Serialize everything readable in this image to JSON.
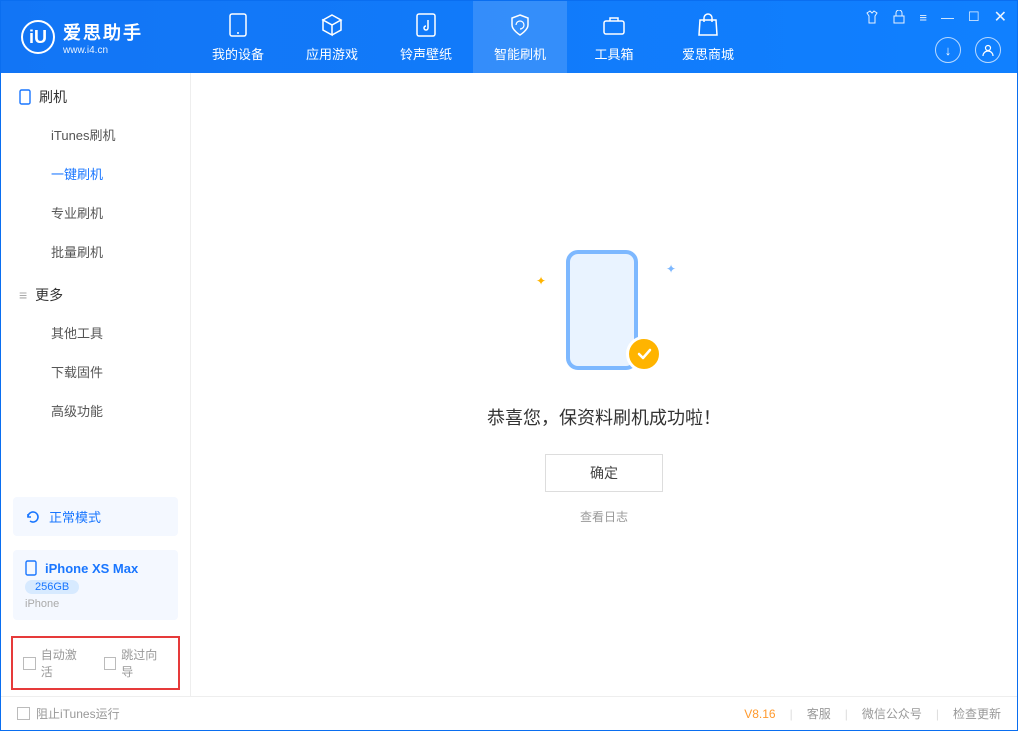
{
  "app": {
    "title": "爱思助手",
    "subtitle": "www.i4.cn"
  },
  "nav": {
    "items": [
      {
        "label": "我的设备"
      },
      {
        "label": "应用游戏"
      },
      {
        "label": "铃声壁纸"
      },
      {
        "label": "智能刷机"
      },
      {
        "label": "工具箱"
      },
      {
        "label": "爱思商城"
      }
    ]
  },
  "sidebar": {
    "section1": {
      "title": "刷机",
      "items": [
        "iTunes刷机",
        "一键刷机",
        "专业刷机",
        "批量刷机"
      ]
    },
    "section2": {
      "title": "更多",
      "items": [
        "其他工具",
        "下载固件",
        "高级功能"
      ]
    }
  },
  "device": {
    "mode_label": "正常模式",
    "name": "iPhone XS Max",
    "storage": "256GB",
    "type": "iPhone"
  },
  "options": {
    "auto_activate": "自动激活",
    "skip_guide": "跳过向导"
  },
  "main": {
    "success_message": "恭喜您，保资料刷机成功啦！",
    "ok_button": "确定",
    "view_log": "查看日志"
  },
  "footer": {
    "block_itunes": "阻止iTunes运行",
    "version": "V8.16",
    "links": [
      "客服",
      "微信公众号",
      "检查更新"
    ]
  }
}
